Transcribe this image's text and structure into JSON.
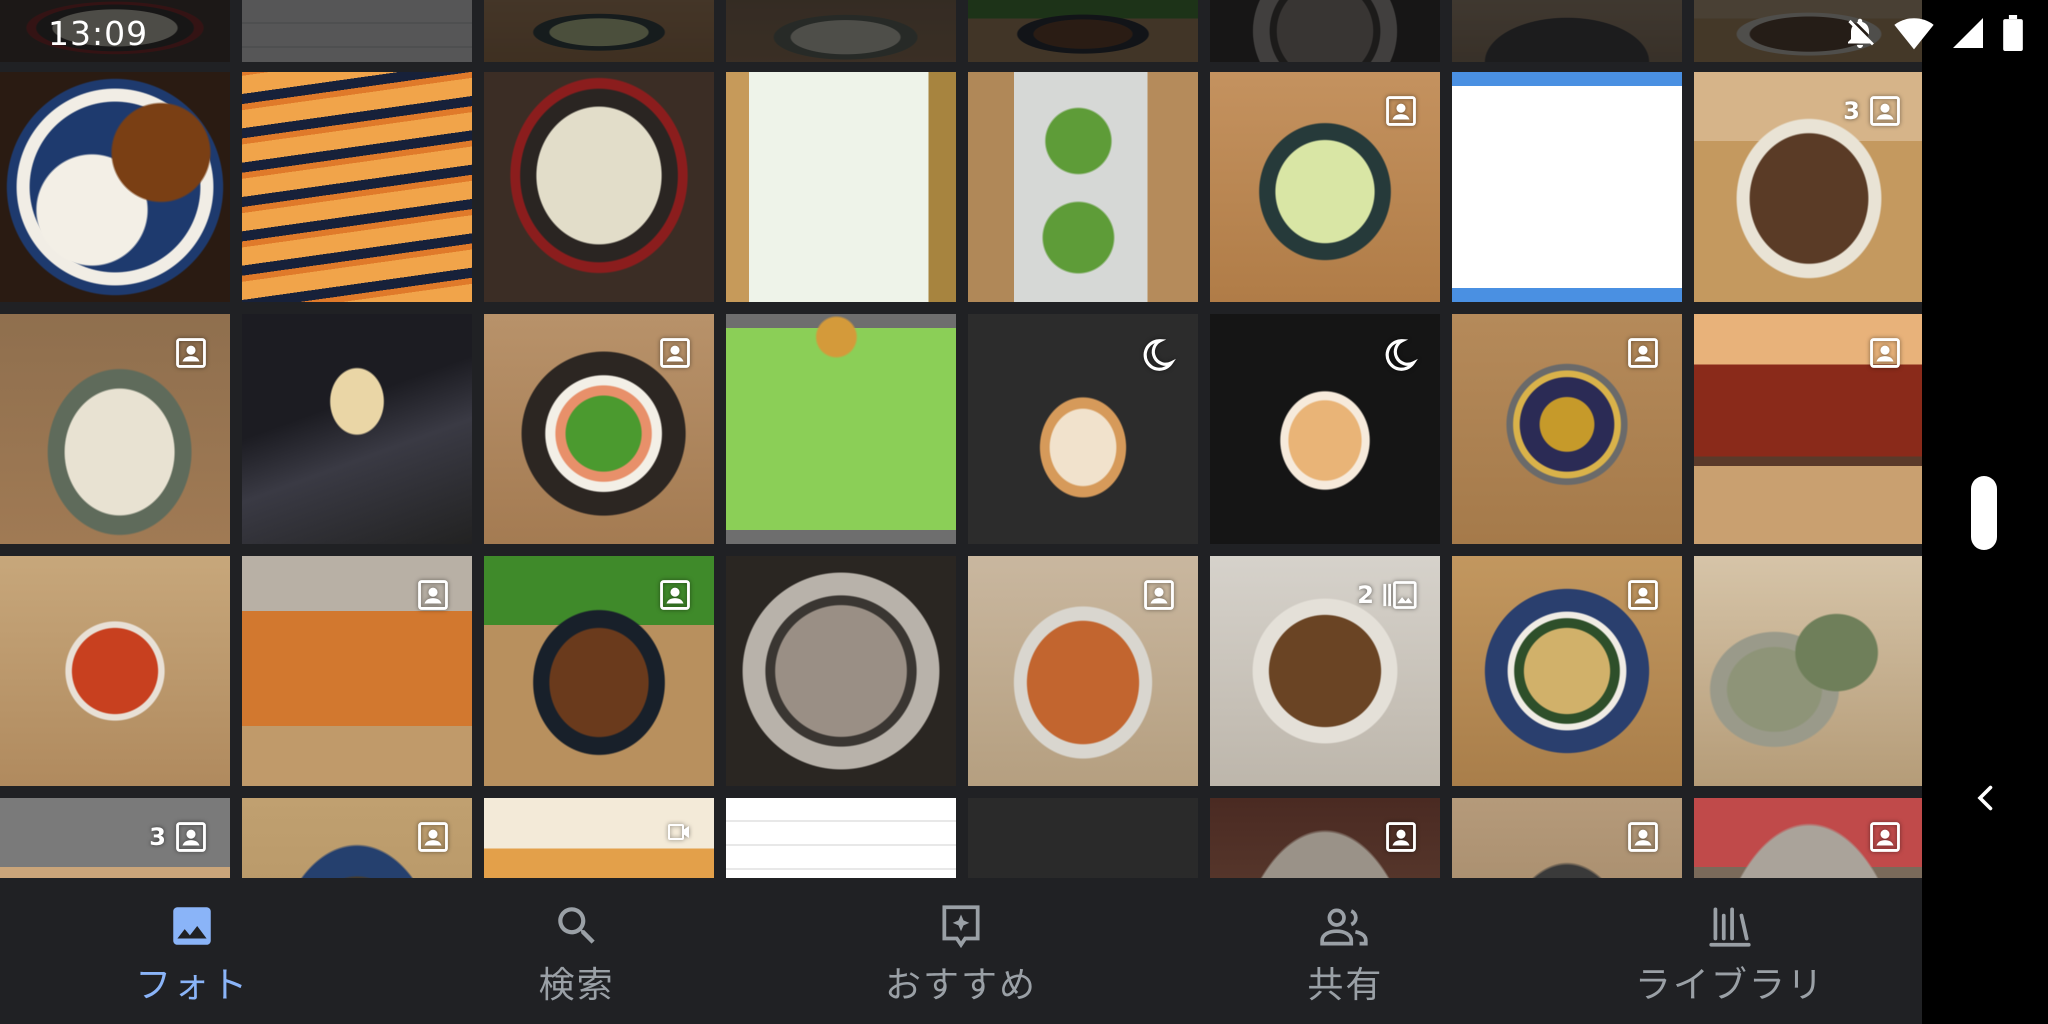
{
  "status_bar": {
    "time": "13:09",
    "icons": [
      "notifications-off-icon",
      "wifi-icon",
      "cellular-signal-icon",
      "battery-icon"
    ]
  },
  "photo_grid": {
    "tiles": [
      {
        "scene": "food-rice-curry",
        "overlay": null
      },
      {
        "scene": "food-spring-rolls",
        "overlay": null
      },
      {
        "scene": "food-hotpot",
        "overlay": null
      },
      {
        "scene": "product-sansho-package",
        "overlay": null
      },
      {
        "scene": "product-vacuum-pack",
        "overlay": null
      },
      {
        "scene": "food-salad",
        "overlay": {
          "icon": "portrait-icon",
          "count": ""
        }
      },
      {
        "scene": "screenshot-webpage",
        "overlay": null
      },
      {
        "scene": "food-grilled-eggplant",
        "overlay": {
          "icon": "portrait-icon",
          "count": "3"
        }
      },
      {
        "scene": "food-pasta",
        "overlay": {
          "icon": "portrait-icon",
          "count": ""
        }
      },
      {
        "scene": "food-soft-serve",
        "overlay": null
      },
      {
        "scene": "food-salmon-salad",
        "overlay": {
          "icon": "portrait-icon",
          "count": ""
        }
      },
      {
        "scene": "note-sketch",
        "overlay": null
      },
      {
        "scene": "cat-night-1",
        "overlay": {
          "icon": "night-mode-icon",
          "count": ""
        }
      },
      {
        "scene": "cat-night-2",
        "overlay": {
          "icon": "night-mode-icon",
          "count": ""
        }
      },
      {
        "scene": "can-pork",
        "overlay": {
          "icon": "portrait-icon",
          "count": ""
        }
      },
      {
        "scene": "can-pork-side",
        "overlay": {
          "icon": "portrait-icon",
          "count": ""
        }
      },
      {
        "scene": "can-saba-top",
        "overlay": null
      },
      {
        "scene": "can-saba-side",
        "overlay": {
          "icon": "portrait-icon",
          "count": ""
        }
      },
      {
        "scene": "food-karaage",
        "overlay": {
          "icon": "portrait-icon",
          "count": ""
        }
      },
      {
        "scene": "food-yakiniku",
        "overlay": null
      },
      {
        "scene": "food-kimchi",
        "overlay": {
          "icon": "portrait-icon",
          "count": ""
        }
      },
      {
        "scene": "food-minced-meat",
        "overlay": {
          "icon": "collage-icon",
          "count": "2"
        }
      },
      {
        "scene": "food-curry-plate",
        "overlay": {
          "icon": "portrait-icon",
          "count": ""
        }
      },
      {
        "scene": "food-green-bowl",
        "overlay": null
      },
      {
        "scene": "table-partial",
        "overlay": {
          "icon": "portrait-icon",
          "count": "3"
        }
      },
      {
        "scene": "food-stirfry-partial",
        "overlay": {
          "icon": "portrait-icon",
          "count": ""
        }
      },
      {
        "scene": "food-broccoli-partial",
        "overlay": {
          "icon": "video-icon",
          "count": ""
        }
      },
      {
        "scene": "screenshot-text-1",
        "overlay": null
      },
      {
        "scene": "screenshot-text-2",
        "overlay": null
      },
      {
        "scene": "yakiniku-grill-partial",
        "overlay": {
          "icon": "portrait-icon",
          "count": ""
        }
      },
      {
        "scene": "food-dark-partial",
        "overlay": {
          "icon": "portrait-icon",
          "count": ""
        }
      },
      {
        "scene": "yakiniku-grill-partial-2",
        "overlay": {
          "icon": "portrait-icon",
          "count": ""
        }
      }
    ]
  },
  "bottom_nav": {
    "items": [
      {
        "label": "フォト",
        "icon": "photo-icon",
        "active": true
      },
      {
        "label": "検索",
        "icon": "search-icon",
        "active": false
      },
      {
        "label": "おすすめ",
        "icon": "for-you-icon",
        "active": false
      },
      {
        "label": "共有",
        "icon": "sharing-icon",
        "active": false
      },
      {
        "label": "ライブラリ",
        "icon": "library-icon",
        "active": false
      }
    ]
  },
  "colors": {
    "background": "#202124",
    "active": "#8ab4f8",
    "inactive": "#9aa0a6"
  }
}
